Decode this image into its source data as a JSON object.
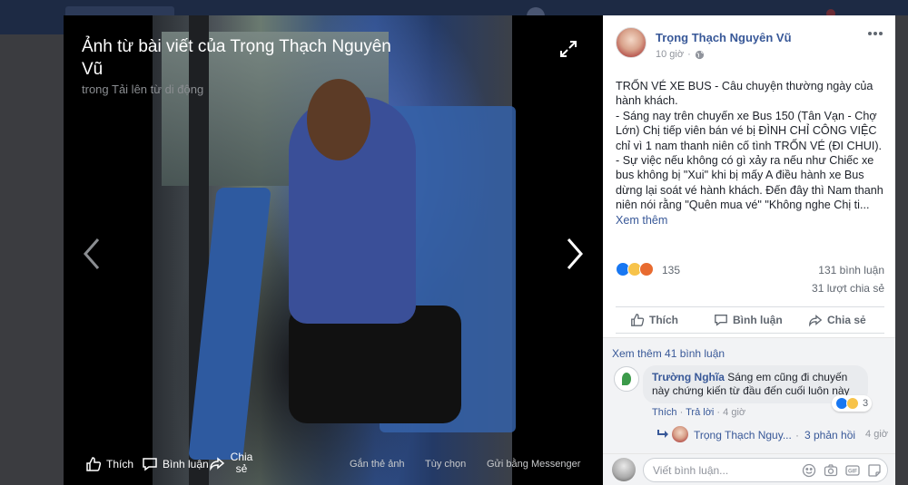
{
  "viewer": {
    "title": "Ảnh từ bài viết của Trọng Thạch Nguyên Vũ",
    "subtitle_prefix": "trong ",
    "subtitle_link": "Tải lên từ di động",
    "actions": {
      "like": "Thích",
      "comment": "Bình luận",
      "share": "Chia sẻ"
    },
    "options": {
      "tag": "Gắn thẻ ảnh",
      "options": "Tùy chọn",
      "messenger": "Gửi bằng Messenger"
    }
  },
  "post": {
    "author": "Trọng Thạch Nguyên Vũ",
    "time": "10 giờ",
    "body": [
      "TRỐN VÉ XE BUS - Câu chuyện thường ngày của hành khách.",
      "- Sáng nay trên chuyến xe Bus 150 (Tân Vạn - Chợ Lớn) Chị tiếp viên bán vé bị ĐÌNH CHỈ CÔNG VIỆC chỉ vì 1 nam thanh niên cố tình TRỐN VÉ (ĐI CHUI).",
      "- Sự việc nếu không có gì xảy ra nếu như Chiếc xe bus không bị \"Xui\" khi bị mấy A điều hành xe Bus dừng lại soát vé hành khách. Đến đây thì Nam thanh niên nói rằng \"Quên mua vé\" \"Không nghe Chị ti..."
    ],
    "see_more": "Xem thêm",
    "reaction_count": "135",
    "comments_count": "131 bình luận",
    "shares_count": "31 lượt chia sẻ",
    "actions": {
      "like": "Thích",
      "comment": "Bình luận",
      "share": "Chia sẻ"
    }
  },
  "comments": {
    "view_more": "Xem thêm 41 bình luận",
    "items": [
      {
        "author": "Trường Nghĩa",
        "text": "Sáng em cũng đi chuyến này chứng kiến từ đầu đến cuối luôn này",
        "reaction_count": "3",
        "like": "Thích",
        "reply": "Trả lời",
        "time": "4 giờ"
      }
    ],
    "reply_thread": {
      "author": "Trọng Thạch Nguy...",
      "separator": "·",
      "count": "3 phản hồi",
      "time": "4 giờ"
    },
    "compose_placeholder": "Viết bình luận..."
  },
  "colors": {
    "link": "#385898",
    "like_blue": "#1877f2",
    "panel_bg": "#ffffff",
    "overlay_bg": "#3b3c40"
  }
}
